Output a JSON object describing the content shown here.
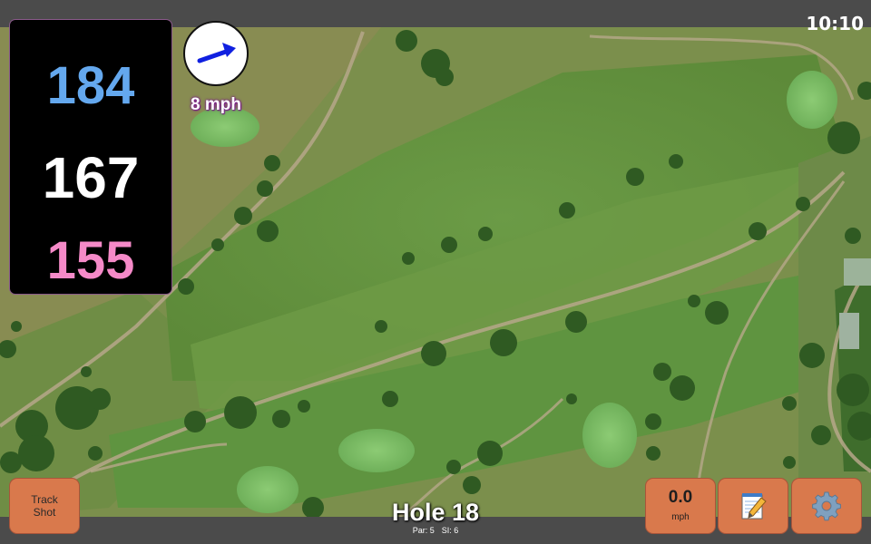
{
  "status": {
    "time": "10:10"
  },
  "distances": {
    "back": "184",
    "center": "167",
    "front": "155",
    "colors": {
      "back": "#64a8ee",
      "center": "#ffffff",
      "front": "#f58ac8"
    }
  },
  "wind": {
    "speed": "8 mph",
    "icon": "wind-direction-arrow-icon",
    "arrow_color": "#1020e0"
  },
  "hole": {
    "title": "Hole 18",
    "par": "Par: 5",
    "si": "SI: 6"
  },
  "buttons": {
    "track_shot": {
      "line1": "Track",
      "line2": "Shot"
    },
    "speed": {
      "value": "0.0",
      "unit": "mph"
    },
    "notes": {
      "icon": "notepad-pencil-icon"
    },
    "settings": {
      "icon": "gear-icon"
    },
    "color": "#d9794c"
  },
  "map": {
    "icon": "satellite-course-map"
  }
}
